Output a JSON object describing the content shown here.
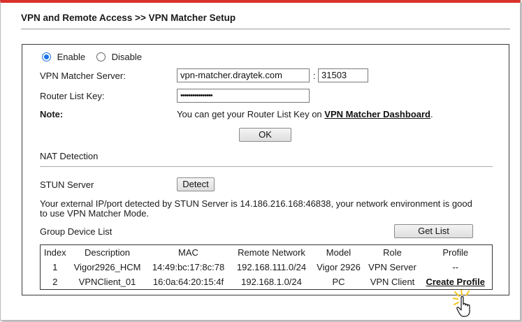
{
  "page_title": "VPN and Remote Access >> VPN Matcher Setup",
  "status": {
    "enable_label": "Enable",
    "disable_label": "Disable",
    "selected": "Enable"
  },
  "server": {
    "label": "VPN Matcher Server:",
    "host_value": "vpn-matcher.draytek.com",
    "separator": ":",
    "port_value": "31503"
  },
  "key": {
    "label": "Router List Key:",
    "masked_value": "••••••••••••••••"
  },
  "note": {
    "label": "Note:",
    "text": "You can get your Router List Key on",
    "link": "VPN Matcher Dashboard",
    "suffix": "."
  },
  "ok_label": "OK",
  "nat": {
    "heading": "NAT Detection",
    "stun_label": "STUN Server",
    "detect_label": "Detect",
    "result_line1": "Your external IP/port detected by STUN Server is 14.186.216.168:46838, your network environment is good",
    "result_line2": "to use VPN Matcher Mode."
  },
  "group": {
    "label": "Group Device List",
    "get_list_label": "Get List",
    "columns": [
      "Index",
      "Description",
      "MAC",
      "Remote Network",
      "Model",
      "Role",
      "Profile"
    ],
    "rows": [
      {
        "index": "1",
        "description": "Vigor2926_HCM",
        "mac": "14:49:bc:17:8c:78",
        "network": "192.168.111.0/24",
        "model": "Vigor 2926",
        "role": "VPN Server",
        "profile": "--"
      },
      {
        "index": "2",
        "description": "VPNClient_01",
        "mac": "16:0a:64:20:15:4f",
        "network": "192.168.1.0/24",
        "model": "PC",
        "role": "VPN Client",
        "profile": "Create Profile"
      }
    ]
  },
  "colors": {
    "accent_top_border": "#d9312b",
    "radio_selected": "#1a73e8",
    "cursor_glow": "#f5c518"
  },
  "icons": {
    "cursor": "hand-pointer-icon"
  }
}
